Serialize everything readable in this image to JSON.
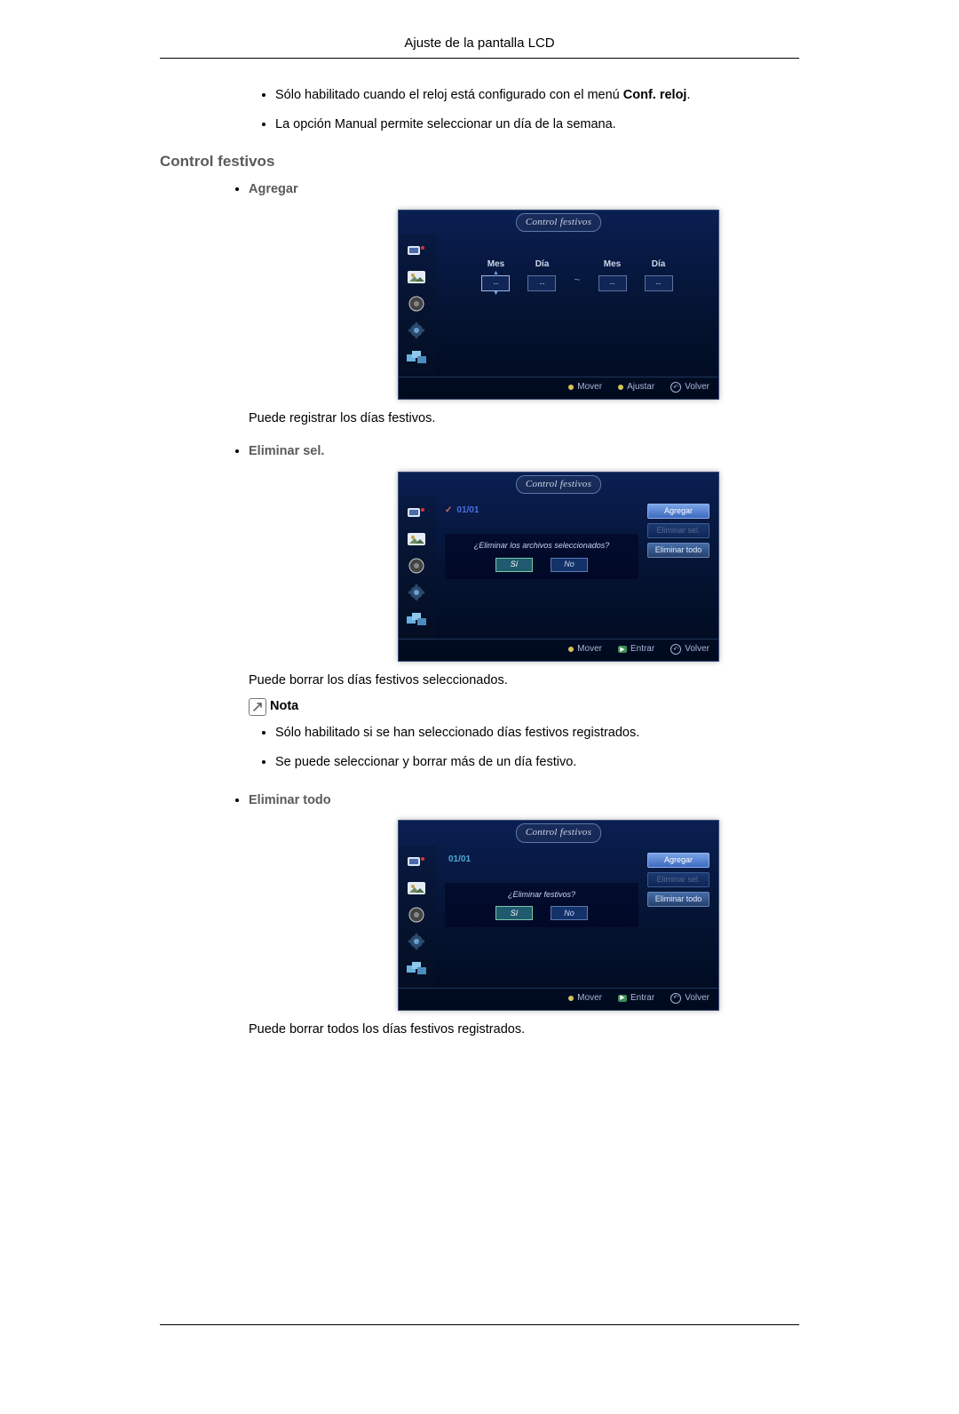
{
  "header": {
    "title": "Ajuste de la pantalla LCD"
  },
  "intro_bullets": [
    {
      "pre": "Sólo habilitado cuando el reloj está configurado con el menú ",
      "bold": "Conf. reloj",
      "post": "."
    },
    {
      "pre": "La opción Manual permite seleccionar un día de la semana.",
      "bold": "",
      "post": ""
    }
  ],
  "section_title": "Control festivos",
  "agregar": {
    "label": "Agregar",
    "osd_title": "Control festivos",
    "cols": [
      {
        "label": "Mes",
        "value": "--"
      },
      {
        "label": "Día",
        "value": "--"
      },
      {
        "label": "Mes",
        "value": "--"
      },
      {
        "label": "Día",
        "value": "--"
      }
    ],
    "footer": {
      "mover": "Mover",
      "ajustar": "Ajustar",
      "volver": "Volver"
    },
    "desc": "Puede registrar los días festivos."
  },
  "eliminar_sel": {
    "label": "Eliminar sel.",
    "osd_title": "Control festivos",
    "date": "01/01",
    "dialog_q": "¿Eliminar los archivos seleccionados?",
    "yes": "Sí",
    "no": "No",
    "btn_agregar": "Agregar",
    "btn_eliminar_sel": "Eliminar sel.",
    "btn_eliminar_todo": "Eliminar todo",
    "footer": {
      "mover": "Mover",
      "entrar": "Entrar",
      "volver": "Volver"
    },
    "desc": "Puede borrar los días festivos seleccionados.",
    "note_label": "Nota",
    "notes": [
      "Sólo habilitado si se han seleccionado días festivos registrados.",
      "Se puede seleccionar y borrar más de un día festivo."
    ]
  },
  "eliminar_todo": {
    "label": "Eliminar todo",
    "osd_title": "Control festivos",
    "date": "01/01",
    "dialog_q": "¿Eliminar festivos?",
    "yes": "Sí",
    "no": "No",
    "btn_agregar": "Agregar",
    "btn_eliminar_sel": "Eliminar sel.",
    "btn_eliminar_todo": "Eliminar todo",
    "footer": {
      "mover": "Mover",
      "entrar": "Entrar",
      "volver": "Volver"
    },
    "desc": "Puede borrar todos los días festivos registrados."
  }
}
